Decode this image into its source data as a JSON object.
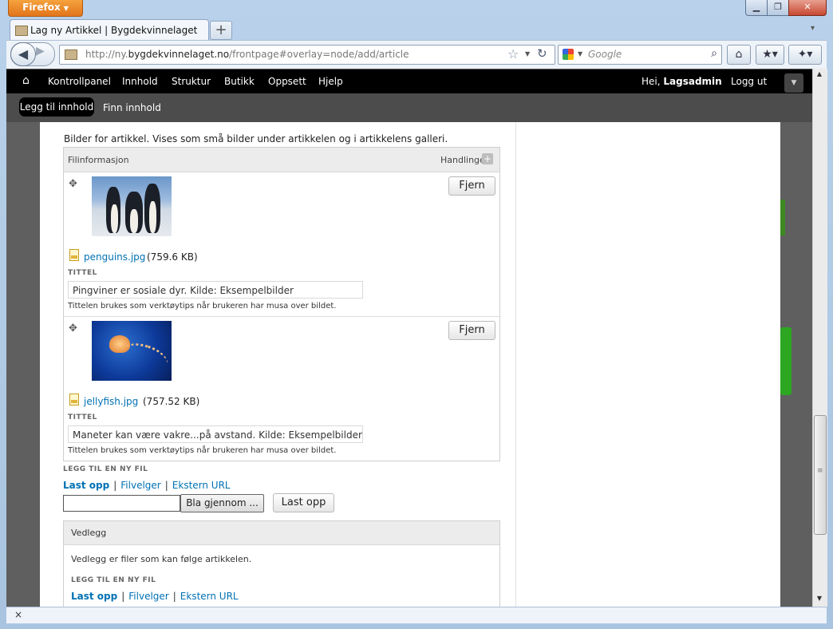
{
  "browser": {
    "app_button": "Firefox",
    "tab_title": "Lag ny Artikkel | Bygdekvinnelaget",
    "new_tab": "+",
    "url_prefix": "http://ny.",
    "url_domain": "bygdekvinnelaget.no",
    "url_path": "/frontpage#overlay=node/add/article",
    "search_placeholder": "Google",
    "status_close": "×"
  },
  "toolbar": {
    "items": [
      "Kontrollpanel",
      "Innhold",
      "Struktur",
      "Butikk",
      "Oppsett",
      "Hjelp"
    ],
    "greeting_prefix": "Hei,",
    "user": "Lagsadmin",
    "logout": "Logg ut",
    "shortcuts": [
      "Legg til innhold",
      "Finn innhold"
    ]
  },
  "images_field": {
    "description": "Bilder for artikkel. Vises som små bilder under artikkelen og i artikkelens galleri.",
    "header_info": "Filinformasjon",
    "header_actions": "Handlinger",
    "remove_label": "Fjern",
    "title_label": "TITTEL",
    "title_help": "Tittelen brukes som verktøytips når brukeren har musa over bildet.",
    "files": [
      {
        "name": "penguins.jpg",
        "size": "(759.6 KB)",
        "title": "Pingviner er sosiale dyr. Kilde: Eksempelbilder"
      },
      {
        "name": "jellyfish.jpg",
        "size": "(757.52 KB)",
        "title": "Maneter kan være vakre...på avstand. Kilde: Eksempelbilder"
      }
    ],
    "add_new_label": "LEGG TIL EN NY FIL",
    "source_links": [
      "Last opp",
      "Filvelger",
      "Ekstern URL"
    ],
    "separator": "|",
    "browse_label": "Bla gjennom ...",
    "upload_label": "Last opp"
  },
  "attachments": {
    "title": "Vedlegg",
    "description": "Vedlegg er filer som kan følge artikkelen.",
    "add_new_label": "LEGG TIL EN NY FIL",
    "source_links": [
      "Last opp",
      "Filvelger",
      "Ekstern URL"
    ]
  }
}
